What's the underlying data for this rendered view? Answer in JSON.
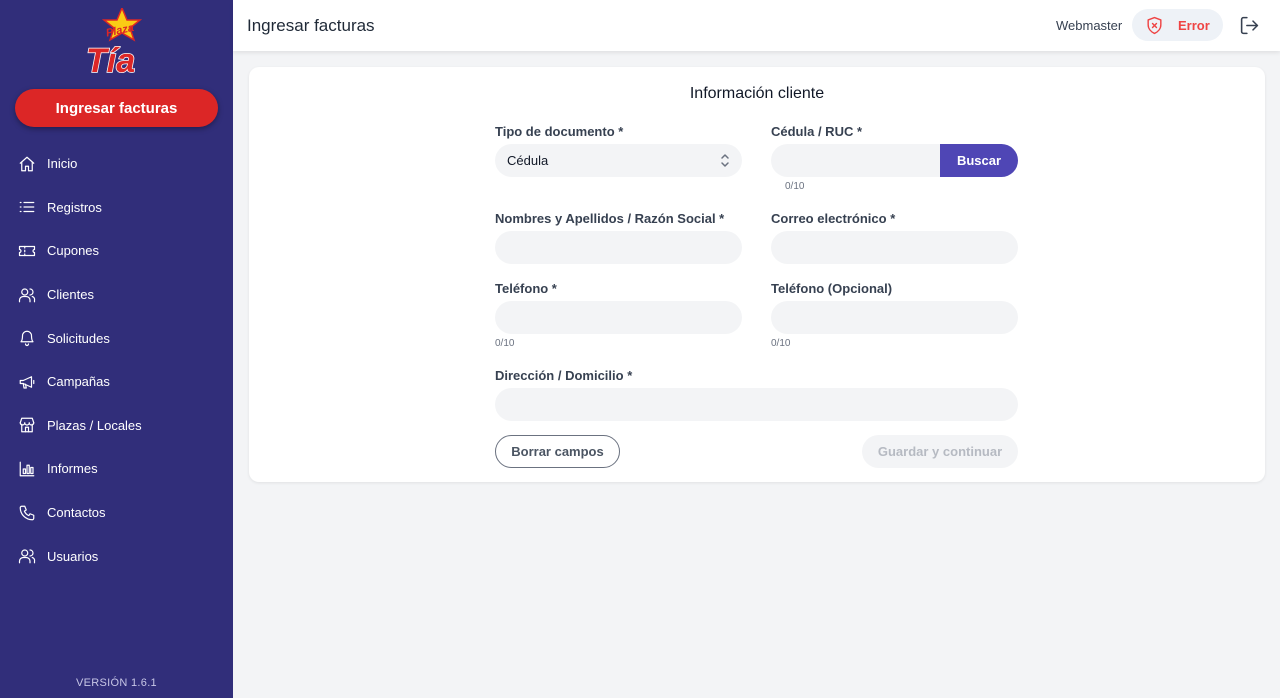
{
  "brand": {
    "logo_small_text": "Plaza",
    "logo_large_text": "Tía"
  },
  "sidebar": {
    "primary_button": "Ingresar facturas",
    "items": [
      {
        "label": "Inicio",
        "icon": "home-icon"
      },
      {
        "label": "Registros",
        "icon": "list-icon"
      },
      {
        "label": "Cupones",
        "icon": "ticket-icon"
      },
      {
        "label": "Clientes",
        "icon": "users-icon"
      },
      {
        "label": "Solicitudes",
        "icon": "bell-icon"
      },
      {
        "label": "Campañas",
        "icon": "megaphone-icon"
      },
      {
        "label": "Plazas / Locales",
        "icon": "store-icon"
      },
      {
        "label": "Informes",
        "icon": "chart-icon"
      },
      {
        "label": "Contactos",
        "icon": "phone-icon"
      },
      {
        "label": "Usuarios",
        "icon": "users-icon"
      }
    ],
    "version": "VERSIÓN 1.6.1"
  },
  "header": {
    "title": "Ingresar facturas",
    "user": "Webmaster",
    "status": "Error"
  },
  "form": {
    "title": "Información cliente",
    "doc_type_label": "Tipo de documento *",
    "doc_type_value": "Cédula",
    "id_label": "Cédula / RUC *",
    "id_value": "",
    "id_counter": "0/10",
    "search_button": "Buscar",
    "name_label": "Nombres y Apellidos / Razón Social *",
    "name_value": "",
    "email_label": "Correo electrónico *",
    "email_value": "",
    "phone_label": "Teléfono *",
    "phone_value": "",
    "phone_counter": "0/10",
    "phone2_label": "Teléfono (Opcional)",
    "phone2_value": "",
    "phone2_counter": "0/10",
    "address_label": "Dirección / Domicilio *",
    "address_value": "",
    "clear_button": "Borrar campos",
    "submit_button": "Guardar y continuar"
  },
  "colors": {
    "sidebar_bg": "#312e7a",
    "primary_red": "#dc2626",
    "accent_purple": "#4f46b5",
    "error_red": "#ef4444"
  }
}
